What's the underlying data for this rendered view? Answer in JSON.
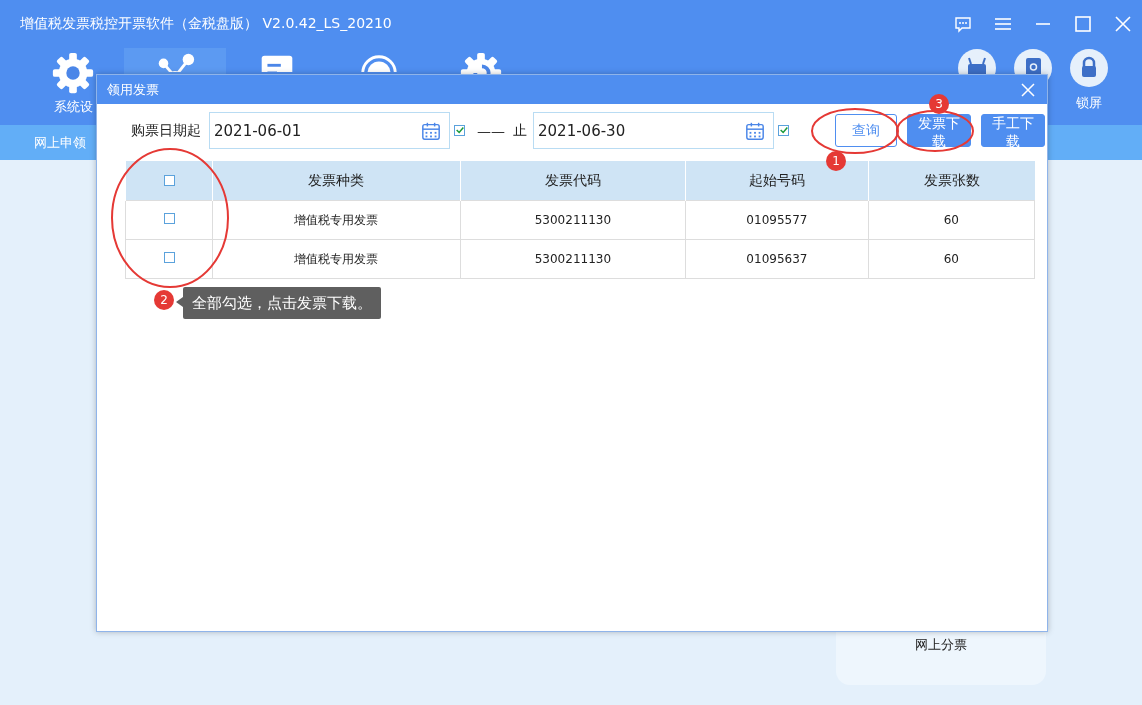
{
  "window": {
    "title": "增值税发票税控开票软件（金税盘版） V2.0.42_LS_20210"
  },
  "toolbar": {
    "items": [
      {
        "kind": "gear",
        "label": "系统设",
        "selected": false
      },
      {
        "kind": "network",
        "selected": true
      },
      {
        "kind": "document",
        "selected": false
      },
      {
        "kind": "tax",
        "selected": false
      },
      {
        "kind": "refresh",
        "selected": false
      }
    ],
    "right_items": [
      {
        "kind": "robot"
      },
      {
        "kind": "help"
      },
      {
        "kind": "lock",
        "label": "锁屏"
      }
    ]
  },
  "subnav": {
    "label": "网上申领"
  },
  "panel": {
    "label": "网上分票"
  },
  "dialog": {
    "title": "领用发票",
    "date_from": {
      "label": "购票日期起",
      "value": "2021-06-01",
      "checked": true
    },
    "separator": "——",
    "date_to": {
      "label": "止",
      "value": "2021-06-30",
      "checked": true
    },
    "buttons": [
      {
        "label": "查询",
        "kind": "outline"
      },
      {
        "label": "发票下载",
        "kind": "primary"
      },
      {
        "label": "手工下载",
        "kind": "primary"
      }
    ],
    "table": {
      "select_all_checked": false,
      "columns": [
        "发票种类",
        "发票代码",
        "起始号码",
        "发票张数"
      ],
      "rows": [
        {
          "checked": false,
          "cells": [
            "增值税专用发票",
            "5300211130",
            "01095577",
            "60"
          ]
        },
        {
          "checked": false,
          "cells": [
            "增值税专用发票",
            "5300211130",
            "01095637",
            "60"
          ]
        }
      ]
    }
  },
  "annotations": {
    "badges": [
      "1",
      "2",
      "3"
    ],
    "callout": "全部勾选，点击发票下载。"
  }
}
